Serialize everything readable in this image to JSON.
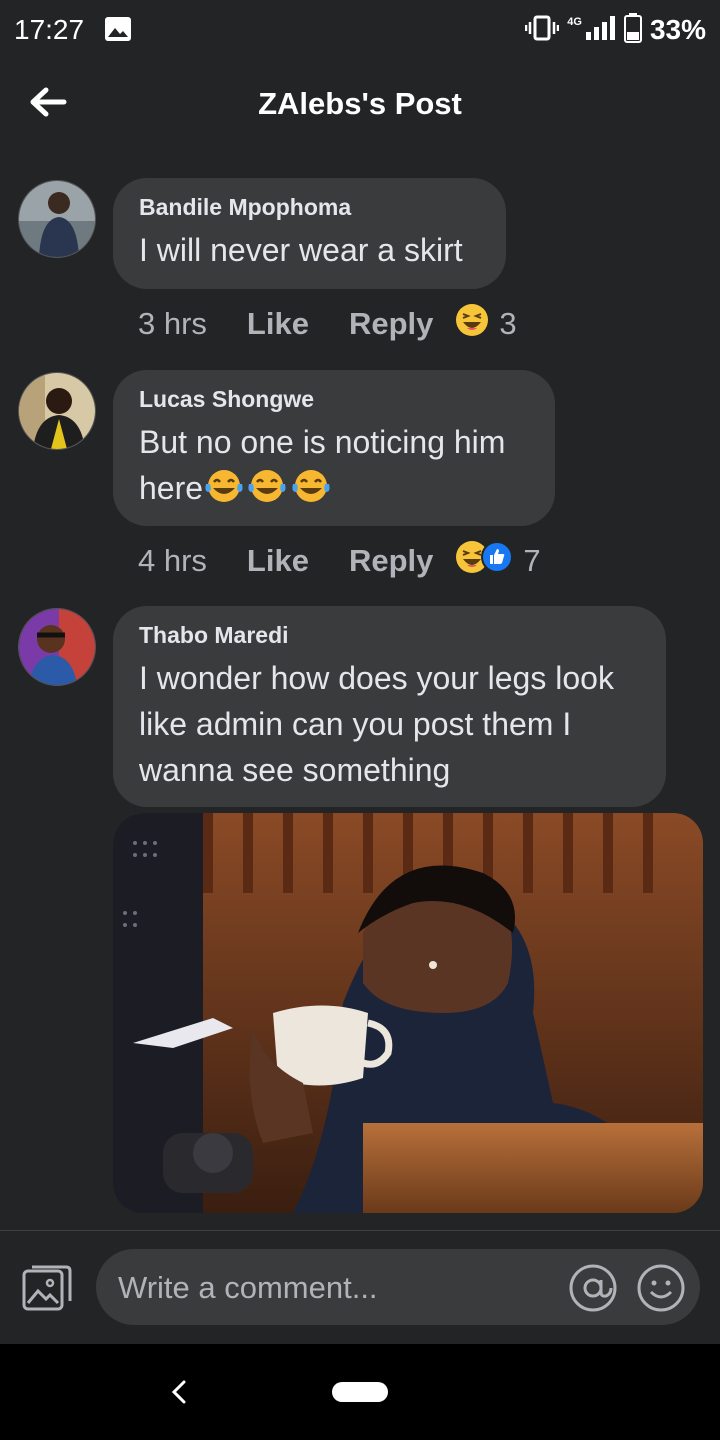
{
  "status": {
    "time": "17:27",
    "network": "4G",
    "battery": "33%"
  },
  "header": {
    "title": "ZAlebs's Post"
  },
  "comments": [
    {
      "author": "Bandile Mpophoma",
      "text": "I will never wear a skirt",
      "time": "3 hrs",
      "like": "Like",
      "reply": "Reply",
      "reaction_count": "3"
    },
    {
      "author": "Lucas Shongwe",
      "text": "But no one is noticing him",
      "text2": "here",
      "time": "4 hrs",
      "like": "Like",
      "reply": "Reply",
      "reaction_count": "7"
    },
    {
      "author": "Thabo Maredi",
      "text": "I wonder how does your legs look like admin can you post them I wanna see something"
    }
  ],
  "composer": {
    "placeholder": "Write a comment..."
  },
  "colors": {
    "background": "#232426",
    "bubble": "#3a3b3c",
    "muted": "#b0b3b8",
    "like_blue": "#1877f2",
    "haha_yellow": "#f7c53a"
  }
}
